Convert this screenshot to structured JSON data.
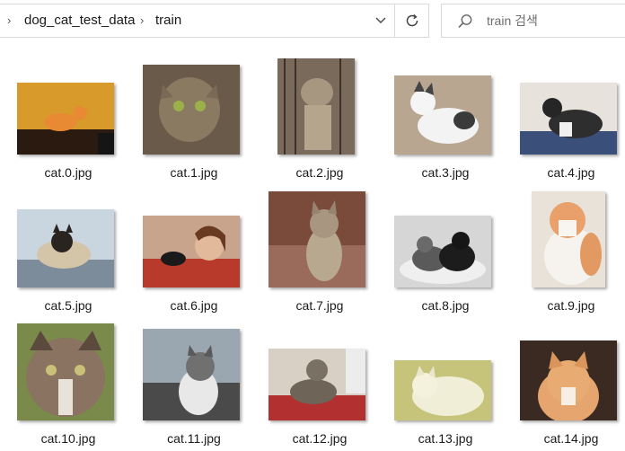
{
  "address": {
    "crumbs": [
      "dog_cat_test_data",
      "train"
    ],
    "separator_icon": "chevron-right-icon",
    "dropdown_icon": "chevron-down-icon",
    "refresh_icon": "refresh-icon"
  },
  "search": {
    "placeholder": "train 검색",
    "icon": "search-icon"
  },
  "files": [
    {
      "name": "cat.0.jpg"
    },
    {
      "name": "cat.1.jpg"
    },
    {
      "name": "cat.2.jpg"
    },
    {
      "name": "cat.3.jpg"
    },
    {
      "name": "cat.4.jpg"
    },
    {
      "name": "cat.5.jpg"
    },
    {
      "name": "cat.6.jpg"
    },
    {
      "name": "cat.7.jpg"
    },
    {
      "name": "cat.8.jpg"
    },
    {
      "name": "cat.9.jpg"
    },
    {
      "name": "cat.10.jpg"
    },
    {
      "name": "cat.11.jpg"
    },
    {
      "name": "cat.12.jpg"
    },
    {
      "name": "cat.13.jpg"
    },
    {
      "name": "cat.14.jpg"
    }
  ]
}
